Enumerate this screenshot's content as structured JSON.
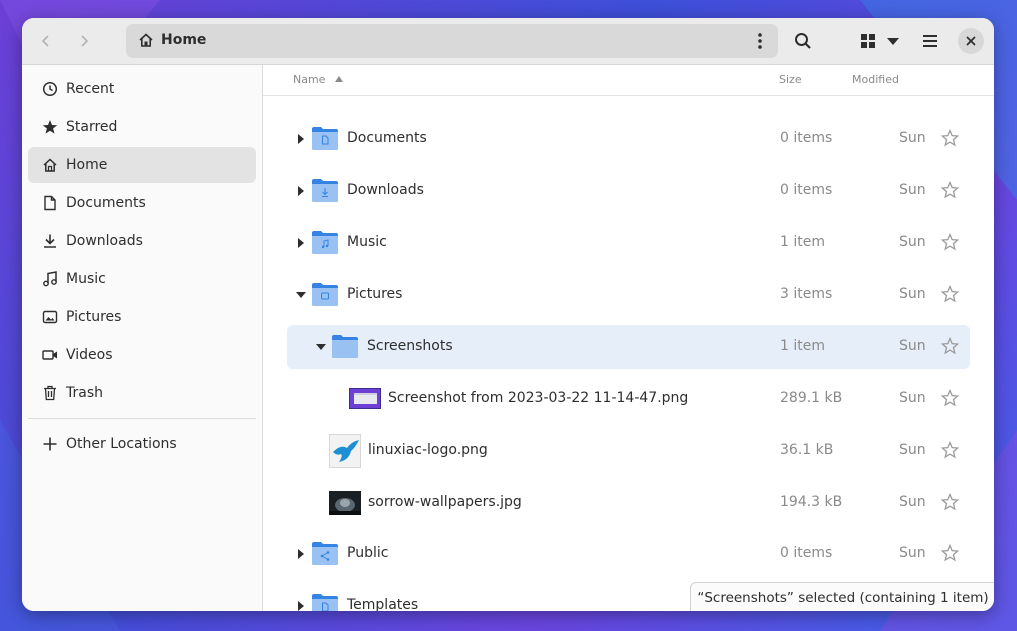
{
  "window": {
    "path_label": "Home",
    "colors": {
      "folder": "#62a0ea",
      "folder_dark": "#3584e4",
      "selected_row": "#e5eef9"
    }
  },
  "headerbar": {
    "back_icon": "chevron-left-icon",
    "forward_icon": "chevron-right-icon",
    "search_icon": "search-icon",
    "view_icon": "grid-view-icon",
    "view_menu_icon": "caret-down-icon",
    "menu_icon": "hamburger-icon",
    "close_icon": "close-icon"
  },
  "sidebar": {
    "items": [
      {
        "label": "Recent",
        "icon": "clock-icon"
      },
      {
        "label": "Starred",
        "icon": "star-icon"
      },
      {
        "label": "Home",
        "icon": "home-icon"
      },
      {
        "label": "Documents",
        "icon": "document-icon"
      },
      {
        "label": "Downloads",
        "icon": "download-icon"
      },
      {
        "label": "Music",
        "icon": "music-icon"
      },
      {
        "label": "Pictures",
        "icon": "picture-icon"
      },
      {
        "label": "Videos",
        "icon": "video-icon"
      },
      {
        "label": "Trash",
        "icon": "trash-icon"
      }
    ],
    "other_locations": {
      "label": "Other Locations",
      "icon": "plus-icon"
    }
  },
  "columns": {
    "name": "Name",
    "size": "Size",
    "modified": "Modified"
  },
  "rows": [
    {
      "name": "Documents",
      "size": "0 items",
      "modified": "Sun",
      "expanded": false
    },
    {
      "name": "Downloads",
      "size": "0 items",
      "modified": "Sun",
      "expanded": false
    },
    {
      "name": "Music",
      "size": "1 item",
      "modified": "Sun",
      "expanded": false
    },
    {
      "name": "Pictures",
      "size": "3 items",
      "modified": "Sun",
      "expanded": true
    },
    {
      "name": "Screenshots",
      "size": "1 item",
      "modified": "Sun",
      "expanded": true
    },
    {
      "name": "Screenshot from 2023-03-22 11-14-47.png",
      "size": "289.1 kB",
      "modified": "Sun"
    },
    {
      "name": "linuxiac-logo.png",
      "size": "36.1 kB",
      "modified": "Sun"
    },
    {
      "name": "sorrow-wallpapers.jpg",
      "size": "194.3 kB",
      "modified": "Sun"
    },
    {
      "name": "Public",
      "size": "0 items",
      "modified": "Sun",
      "expanded": false
    },
    {
      "name": "Templates",
      "size": "",
      "modified": "",
      "expanded": false
    }
  ],
  "status": {
    "text": "“Screenshots” selected  (containing 1 item)"
  }
}
